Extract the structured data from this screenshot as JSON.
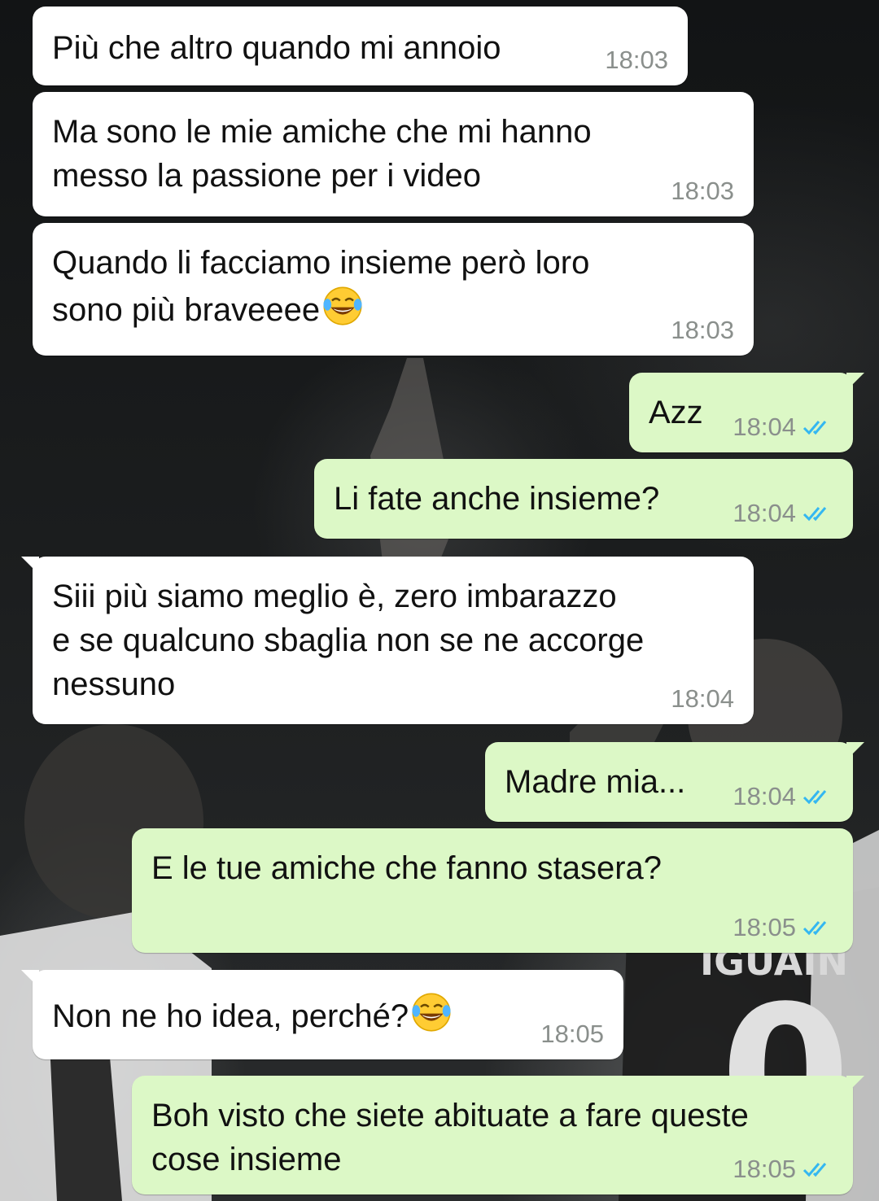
{
  "colors": {
    "incoming_bubble": "#ffffff",
    "outgoing_bubble": "#dcf8c6",
    "timestamp": "#8a8f8c",
    "read_ticks": "#34b7f1"
  },
  "background": {
    "jersey_text": "IGUAIN",
    "jersey_number": "0"
  },
  "messages": [
    {
      "direction": "in",
      "text": "Più che altro quando mi annoio",
      "time": "18:03"
    },
    {
      "direction": "in",
      "text": "Ma sono le mie amiche che mi hanno\nmesso la passione per i video",
      "time": "18:03"
    },
    {
      "direction": "in",
      "text": "Quando li facciamo insieme però loro\nsono più braveeee",
      "emoji": "tears-of-joy",
      "time": "18:03"
    },
    {
      "direction": "out",
      "text": "Azz",
      "time": "18:04",
      "status": "read"
    },
    {
      "direction": "out",
      "text": "Li fate anche insieme?",
      "time": "18:04",
      "status": "read"
    },
    {
      "direction": "in",
      "text": "Siii più siamo meglio è, zero imbarazzo\ne se qualcuno sbaglia non se ne accorge\nnessuno",
      "time": "18:04"
    },
    {
      "direction": "out",
      "text": "Madre mia...",
      "time": "18:04",
      "status": "read"
    },
    {
      "direction": "out",
      "text": "E le tue amiche che fanno stasera?",
      "time": "18:05",
      "status": "read"
    },
    {
      "direction": "in",
      "text": "Non ne ho idea, perché?",
      "emoji": "tears-of-joy",
      "time": "18:05"
    },
    {
      "direction": "out",
      "text": "Boh visto che siete abituate a fare queste\ncose insieme",
      "time": "18:05",
      "status": "read"
    }
  ]
}
